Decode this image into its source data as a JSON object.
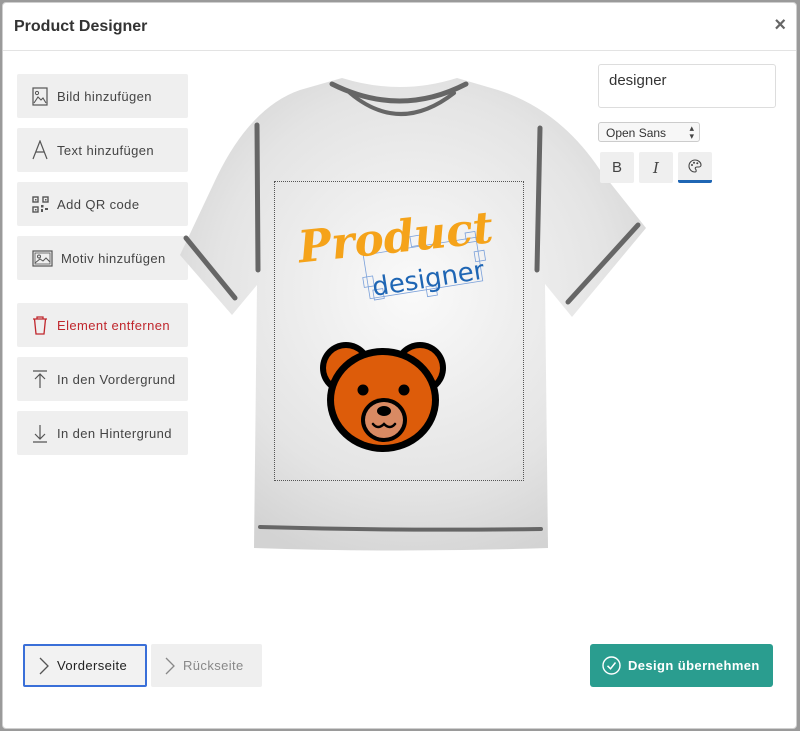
{
  "dialog": {
    "title": "Product Designer",
    "close_glyph": "×"
  },
  "tools": {
    "add_image": "Bild hinzufügen",
    "add_text": "Text hinzufügen",
    "add_qr": "Add QR code",
    "add_motif": "Motiv hinzufügen",
    "remove_element": "Element entfernen",
    "bring_front": "In den Vordergrund",
    "send_back": "In den Hintergrund"
  },
  "icons": {
    "add_image": "image-icon",
    "add_text": "text-icon",
    "add_qr": "qr-code-icon",
    "add_motif": "landscape-icon",
    "remove_element": "trash-icon",
    "bring_front": "arrow-up-to-line-icon",
    "send_back": "arrow-down-to-line-icon",
    "color": "palette-icon",
    "page_nav": "chevron-right-icon",
    "confirm": "check-circle-icon",
    "close": "close-icon"
  },
  "editor": {
    "text_value": "designer",
    "font": "Open Sans",
    "bold_label": "B",
    "italic_label": "I"
  },
  "canvas": {
    "logo_text_1": "Product",
    "logo_text_2": "designer"
  },
  "pages": {
    "front": "Vorderseite",
    "back": "Rückseite"
  },
  "actions": {
    "confirm": "Design übernehmen"
  },
  "colors": {
    "accent": "#2a9d8f",
    "danger": "#c0272d",
    "logo_orange": "#f5a31a",
    "logo_blue": "#1f66b4",
    "bear": "#dd5c0a",
    "active_border": "#3a6fd8"
  }
}
